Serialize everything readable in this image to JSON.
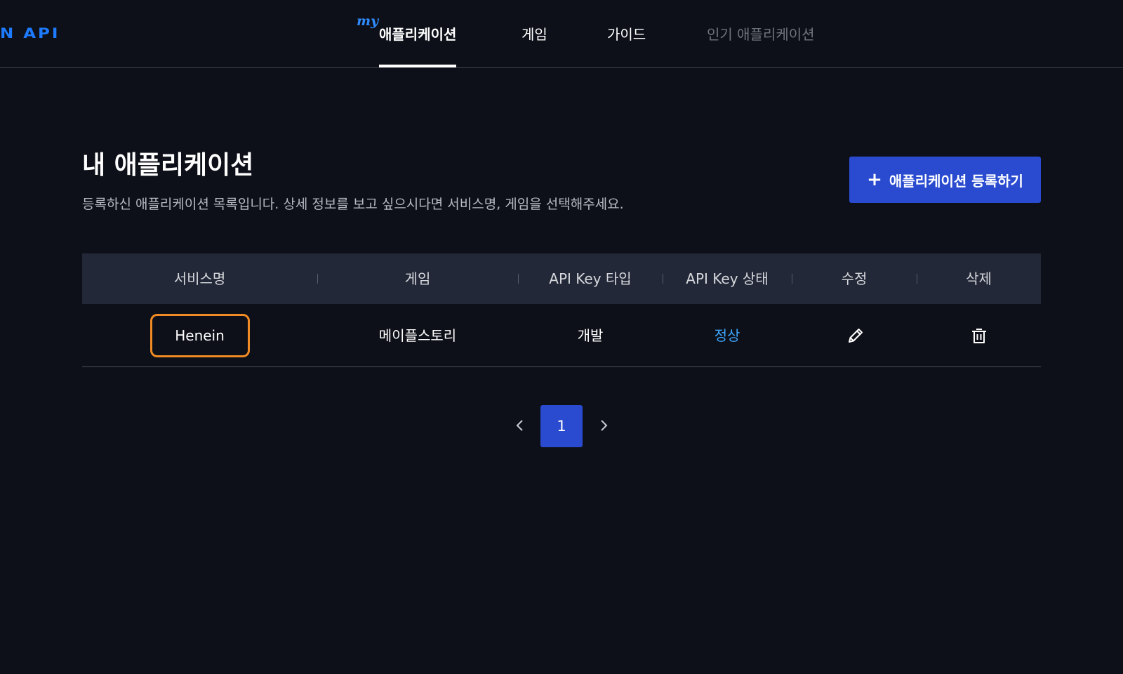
{
  "header": {
    "logo_text": "N API",
    "nav": {
      "my_badge": "my",
      "items": [
        {
          "label": "애플리케이션"
        },
        {
          "label": "게임"
        },
        {
          "label": "가이드"
        },
        {
          "label": "인기 애플리케이션"
        }
      ]
    }
  },
  "page": {
    "title": "내 애플리케이션",
    "description": "등록하신 애플리케이션 목록입니다. 상세 정보를 보고 싶으시다면 서비스명, 게임을 선택해주세요.",
    "register_button": "애플리케이션 등록하기",
    "register_icon": "+"
  },
  "table": {
    "columns": [
      "서비스명",
      "게임",
      "API Key 타입",
      "API Key 상태",
      "수정",
      "삭제"
    ],
    "rows": [
      {
        "service_name": "Henein",
        "game": "메이플스토리",
        "key_type": "개발",
        "key_status": "정상",
        "edit_icon": "pencil-icon",
        "delete_icon": "trash-icon"
      }
    ]
  },
  "pagination": {
    "current_page": "1",
    "prev_icon": "chevron-left-icon",
    "next_icon": "chevron-right-icon"
  },
  "colors": {
    "background": "#0d1018",
    "accent": "#2a4bd0",
    "status_ok": "#3ea6ff",
    "highlight_border": "#f08a24"
  }
}
